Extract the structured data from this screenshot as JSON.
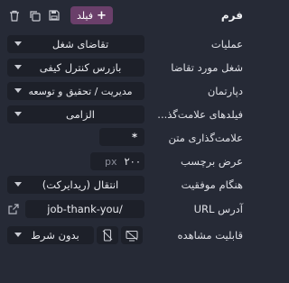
{
  "header": {
    "title": "فرم",
    "add_field_label": "فیلد",
    "icons": [
      "trash-icon",
      "copy-icon",
      "save-icon"
    ]
  },
  "fields": {
    "operations": {
      "label": "عملیات",
      "value": "تقاضای شغل"
    },
    "job": {
      "label": "شغل مورد تقاضا",
      "value": "بازرس کنترل کیفی"
    },
    "department": {
      "label": "دپارتمان",
      "value": "مدیریت / تحقیق و توسعه"
    },
    "required_fields": {
      "label": "فیلدهای علامت‌گذ...",
      "value": "الزامی"
    },
    "text_mark": {
      "label": "علامت‌گذاری متن",
      "value": "*"
    },
    "label_width": {
      "label": "عرض برچسب",
      "value": "۲۰۰",
      "unit": "px"
    },
    "on_success": {
      "label": "هنگام موفقیت",
      "value": "انتقال (ریدایرکت)"
    },
    "url": {
      "label": "آدرس URL",
      "value": "/job-thank-you"
    },
    "visibility": {
      "label": "قابلیت مشاهده",
      "value": "بدون شرط"
    }
  }
}
